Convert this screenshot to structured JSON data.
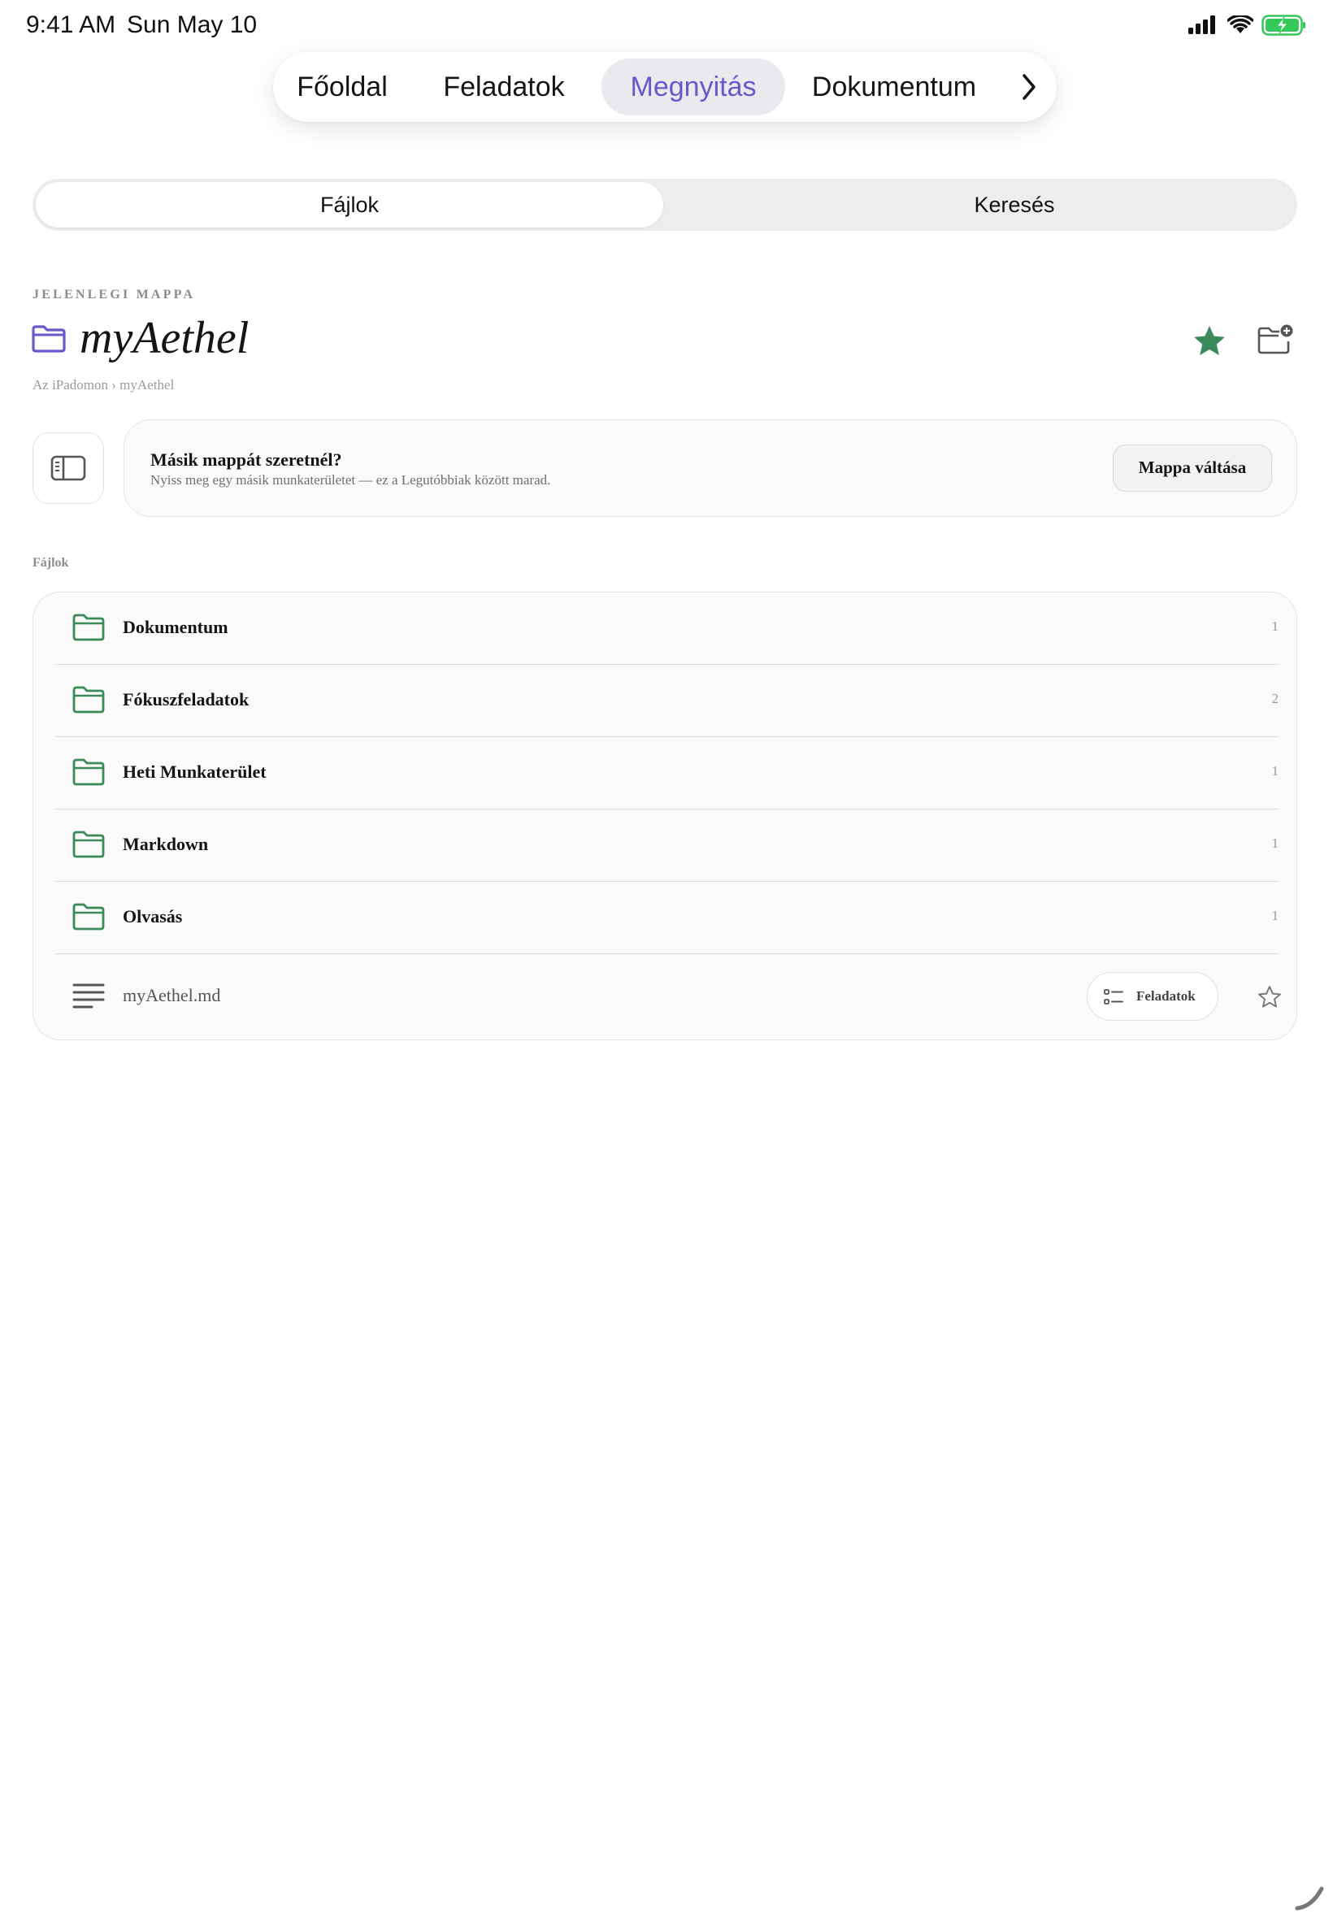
{
  "status_bar": {
    "time": "9:41 AM",
    "date": "Sun May 10",
    "icons": [
      "cellular-signal-icon",
      "wifi-icon",
      "battery-charging-icon"
    ]
  },
  "nav": {
    "items": [
      {
        "label": "Főoldal",
        "active": false
      },
      {
        "label": "Feladatok",
        "active": false
      },
      {
        "label": "Megnyitás",
        "active": true
      },
      {
        "label": "Dokumentum",
        "active": false
      }
    ],
    "more_icon": "chevron-right-icon"
  },
  "segmented": {
    "files_label": "Fájlok",
    "search_label": "Keresés",
    "selected": "Fájlok"
  },
  "folder": {
    "eyebrow": "JELENLEGI MAPPA",
    "title": "myAethel",
    "breadcrumb": "Az iPadomon › myAethel",
    "favorited": true
  },
  "switch_banner": {
    "title": "Másik mappát szeretnél?",
    "subtitle": "Nyiss meg egy másik munkaterületet — ez a Legutóbbiak között marad.",
    "button_label": "Mappa váltása"
  },
  "files": {
    "section_label": "Fájlok",
    "folders": [
      {
        "name": "Dokumentum",
        "count": "1"
      },
      {
        "name": "Fókuszfeladatok",
        "count": "2"
      },
      {
        "name": "Heti Munkaterület",
        "count": "1"
      },
      {
        "name": "Markdown",
        "count": "1"
      },
      {
        "name": "Olvasás",
        "count": "1"
      }
    ],
    "document": {
      "name": "myAethel.md",
      "tasks_label": "Feladatok",
      "favorited": false
    }
  },
  "colors": {
    "accent_purple": "#6a58c9",
    "folder_green": "#3a8a5a",
    "star_green": "#3a8a5a",
    "battery_green": "#34c759"
  }
}
